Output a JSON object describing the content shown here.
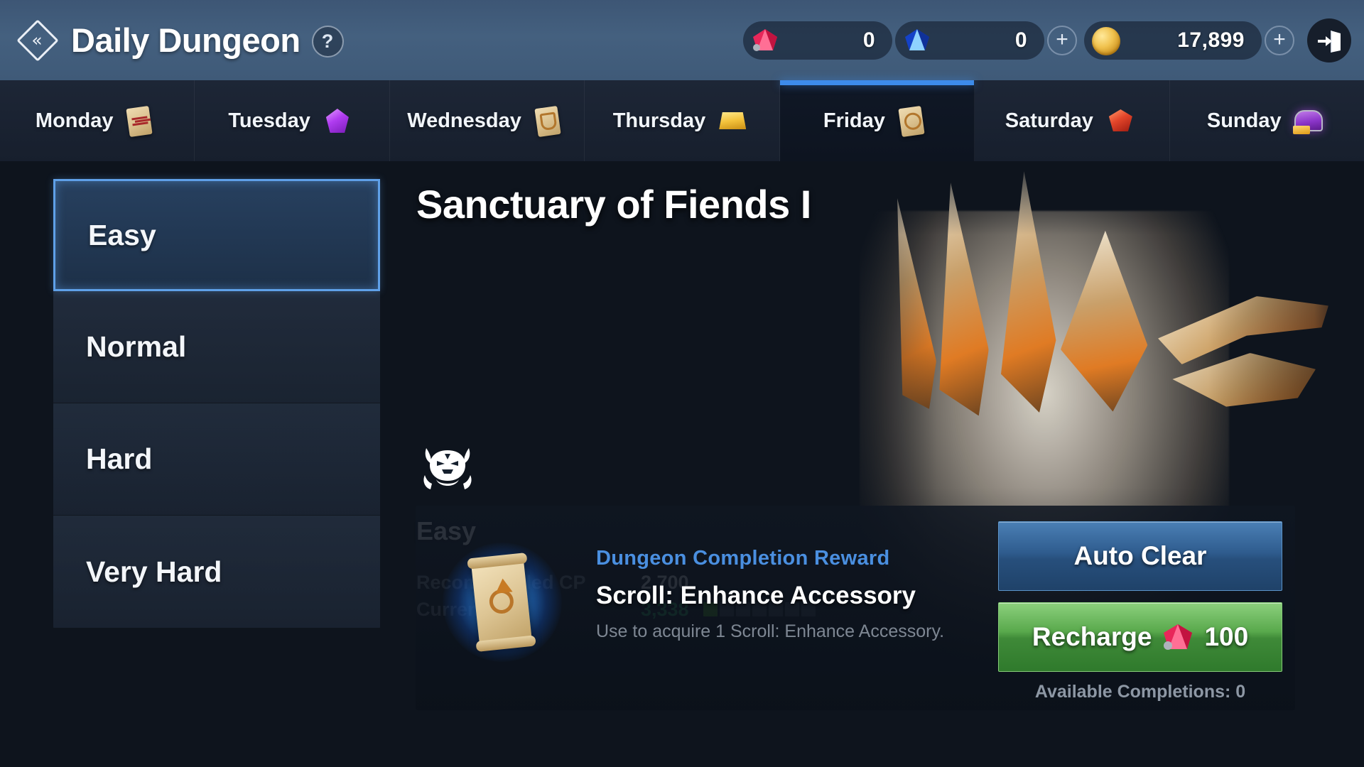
{
  "header": {
    "back_icon": "back-chevron-icon",
    "title": "Daily Dungeon",
    "help_label": "?",
    "currencies": [
      {
        "id": "ruby",
        "icon": "ruby-gem-icon",
        "value": "0",
        "has_plus": false
      },
      {
        "id": "diamond",
        "icon": "blue-diamond-icon",
        "value": "0",
        "has_plus": true,
        "plus_label": "+"
      },
      {
        "id": "gold",
        "icon": "gold-coin-icon",
        "value": "17,899",
        "has_plus": true,
        "plus_label": "+"
      }
    ],
    "exit_icon": "exit-door-icon"
  },
  "tabs": [
    {
      "label": "Monday",
      "icon": "scroll-red-icon",
      "active": false
    },
    {
      "label": "Tuesday",
      "icon": "purple-crystal-icon",
      "active": false
    },
    {
      "label": "Wednesday",
      "icon": "scroll-shield-icon",
      "active": false
    },
    {
      "label": "Thursday",
      "icon": "gold-bar-icon",
      "active": false
    },
    {
      "label": "Friday",
      "icon": "scroll-ring-icon",
      "active": true
    },
    {
      "label": "Saturday",
      "icon": "red-gem-icon",
      "active": false
    },
    {
      "label": "Sunday",
      "icon": "purple-chest-icon",
      "active": false
    }
  ],
  "difficulties": [
    {
      "label": "Easy",
      "selected": true
    },
    {
      "label": "Normal",
      "selected": false
    },
    {
      "label": "Hard",
      "selected": false
    },
    {
      "label": "Very Hard",
      "selected": false
    }
  ],
  "dungeon": {
    "name": "Sanctuary of Fiends I",
    "emblem_icon": "oni-mask-icon",
    "difficulty": "Easy",
    "recommended_cp_label": "Recommended CP",
    "recommended_cp_value": "2,700",
    "current_cp_label": "Current CP",
    "current_cp_value": "3,338",
    "cp_segments_total": 7,
    "cp_segments_filled": 1
  },
  "reward": {
    "icon": "scroll-accessory-icon",
    "kind": "Dungeon Completion Reward",
    "name": "Scroll: Enhance Accessory",
    "description": "Use to acquire 1 Scroll: Enhance Accessory."
  },
  "actions": {
    "auto_clear": "Auto Clear",
    "recharge": "Recharge",
    "recharge_cost": "100",
    "recharge_currency_icon": "ruby-gem-icon",
    "available_completions": "Available Completions: 0"
  },
  "colors": {
    "accent_blue": "#3d8bea",
    "reward_kind_blue": "#4a8fe0",
    "cp_green": "#2fc56b",
    "segment_green": "#4fb81e",
    "button_green": "#59a94c",
    "header_blue": "#44607f",
    "bg_dark": "#0e141d"
  }
}
